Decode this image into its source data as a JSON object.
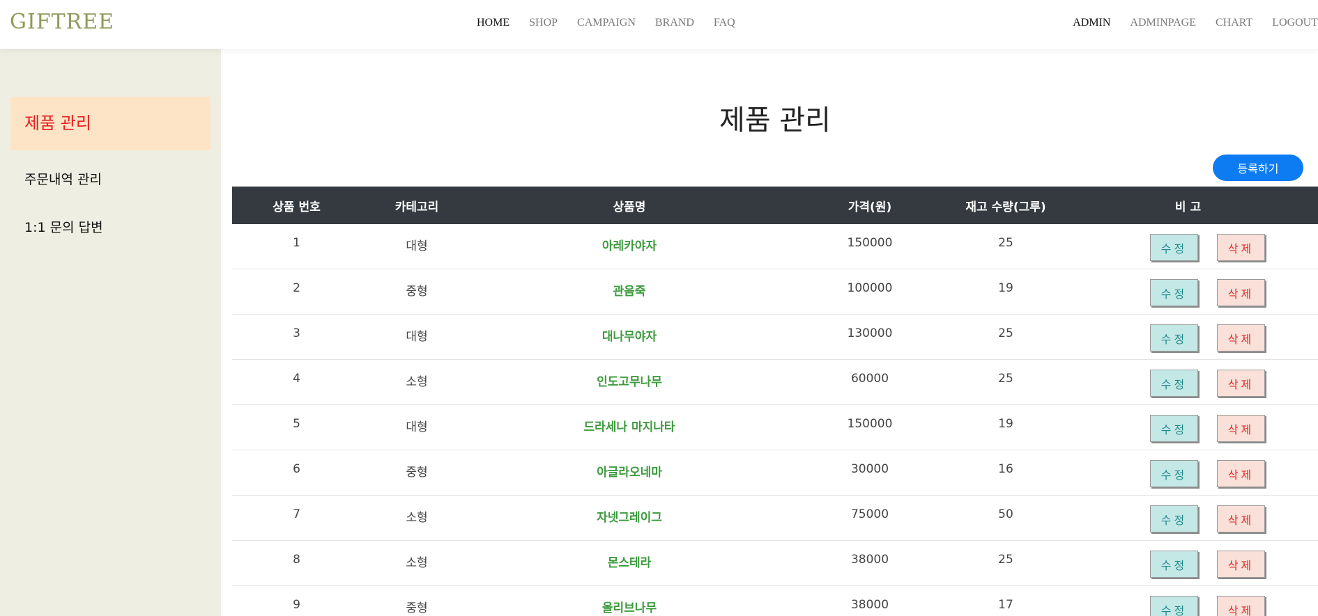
{
  "header": {
    "logo": "GIFTREE",
    "nav": [
      "HOME",
      "SHOP",
      "CAMPAIGN",
      "BRAND",
      "FAQ"
    ],
    "nav_right": [
      "ADMIN",
      "ADMINPAGE",
      "CHART",
      "LOGOUT"
    ]
  },
  "sidebar": {
    "items": [
      {
        "label": "제품 관리",
        "active": true
      },
      {
        "label": "주문내역 관리"
      },
      {
        "label": "1:1 문의 답변"
      }
    ]
  },
  "main": {
    "title": "제품 관리",
    "register_label": "등록하기",
    "columns": [
      "상품 번호",
      "카테고리",
      "상품명",
      "가격(원)",
      "재고 수량(그루)",
      "비 고"
    ],
    "edit_label": "수정",
    "delete_label": "삭제",
    "rows": [
      [
        "1",
        "대형",
        "아레카야자",
        "150000",
        "25"
      ],
      [
        "2",
        "중형",
        "관음죽",
        "100000",
        "19"
      ],
      [
        "3",
        "대형",
        "대나무야자",
        "130000",
        "25"
      ],
      [
        "4",
        "소형",
        "인도고무나무",
        "60000",
        "25"
      ],
      [
        "5",
        "대형",
        "드라세나 마지나타",
        "150000",
        "19"
      ],
      [
        "6",
        "중형",
        "아글라오네마",
        "30000",
        "16"
      ],
      [
        "7",
        "소형",
        "자넷그레이그",
        "75000",
        "50"
      ],
      [
        "8",
        "소형",
        "몬스테라",
        "38000",
        "25"
      ],
      [
        "9",
        "중형",
        "올리브나무",
        "38000",
        "17"
      ]
    ]
  }
}
